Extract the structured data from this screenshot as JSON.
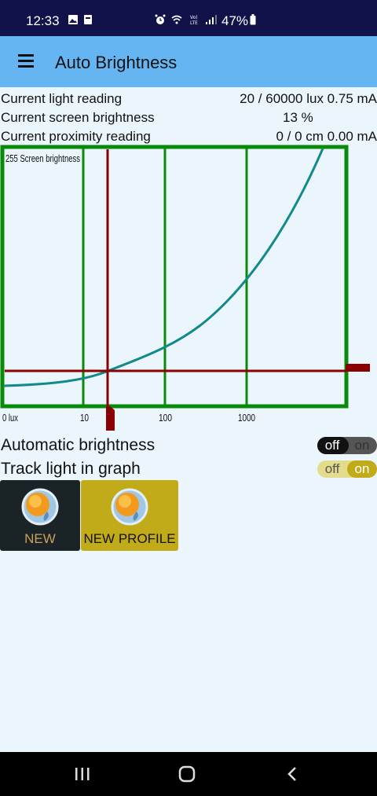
{
  "status_bar": {
    "time": "12:33",
    "battery": "47%"
  },
  "app_bar": {
    "title": "Auto Brightness"
  },
  "readings": [
    {
      "label": "Current light reading",
      "value": "20 / 60000 lux 0.75 mA"
    },
    {
      "label": "Current screen brightness",
      "value": "13 %"
    },
    {
      "label": "Current proximity reading",
      "value": "0 / 0 cm 0.00 mA"
    }
  ],
  "graph": {
    "y_label": "255 Screen brightness",
    "x_ticks": [
      "0 lux",
      "10",
      "100",
      "1000"
    ],
    "colors": {
      "frame": "#0a8a0a",
      "curve": "#138a8a",
      "marker": "#8b0000"
    }
  },
  "settings": {
    "automatic_brightness": {
      "label": "Automatic brightness",
      "off": "off",
      "on": "on",
      "state": "off"
    },
    "track_light": {
      "label": "Track light in graph",
      "off": "off",
      "on": "on",
      "state": "on"
    }
  },
  "profiles": [
    {
      "label": "NEW",
      "icon": "sun-globe-icon"
    },
    {
      "label": "NEW PROFILE",
      "icon": "sun-globe-icon"
    }
  ],
  "nav": {
    "recents": "recents-icon",
    "home": "home-icon",
    "back": "back-icon"
  }
}
